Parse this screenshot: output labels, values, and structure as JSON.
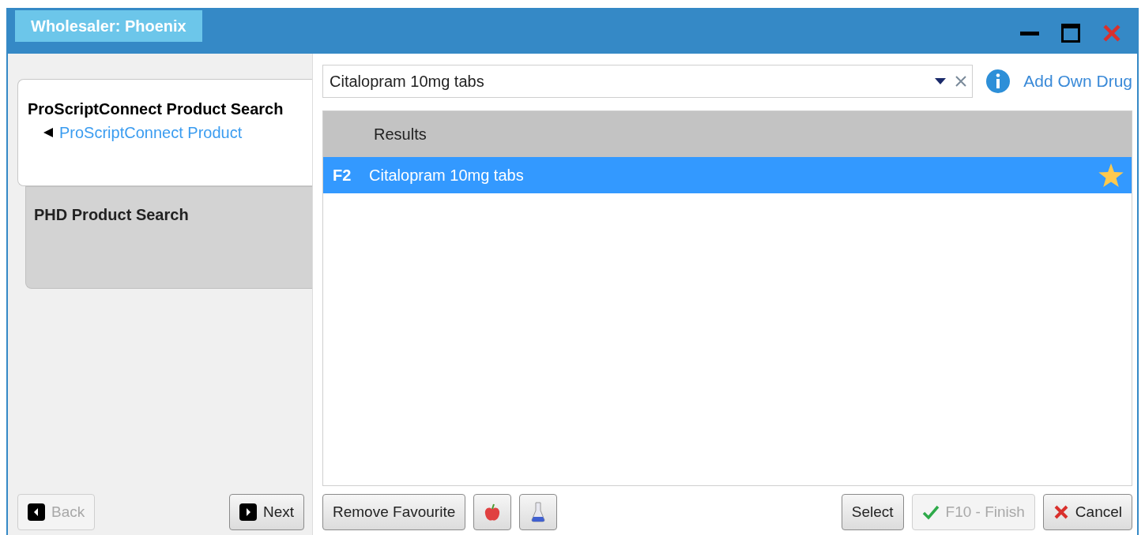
{
  "window": {
    "title": "Wholesaler: Phoenix"
  },
  "steps": [
    {
      "title": "ProScriptConnect Product Search",
      "selected": true,
      "sub_link": "ProScriptConnect Product"
    },
    {
      "title": "PHD Product Search",
      "selected": false
    }
  ],
  "nav_buttons": [
    {
      "kind": "back",
      "label": "Back",
      "disabled": true
    },
    {
      "kind": "next",
      "label": "Next",
      "disabled": false
    }
  ],
  "search": {
    "value": "Citalopram 10mg tabs"
  },
  "add_own_drug": "Add Own Drug",
  "results": {
    "header": "Results",
    "rows": [
      {
        "key": "F2",
        "name": "Citalopram 10mg tabs",
        "favourite": true,
        "selected": true
      }
    ]
  },
  "left_actions": [
    {
      "kind": "text",
      "label": "Remove Favourite"
    },
    {
      "kind": "apple"
    },
    {
      "kind": "flask"
    }
  ],
  "right_actions": [
    {
      "kind": "select",
      "label": "Select",
      "disabled": false
    },
    {
      "kind": "finish",
      "label": "F10 - Finish",
      "disabled": true
    },
    {
      "kind": "cancel",
      "label": "Cancel",
      "disabled": false
    }
  ]
}
